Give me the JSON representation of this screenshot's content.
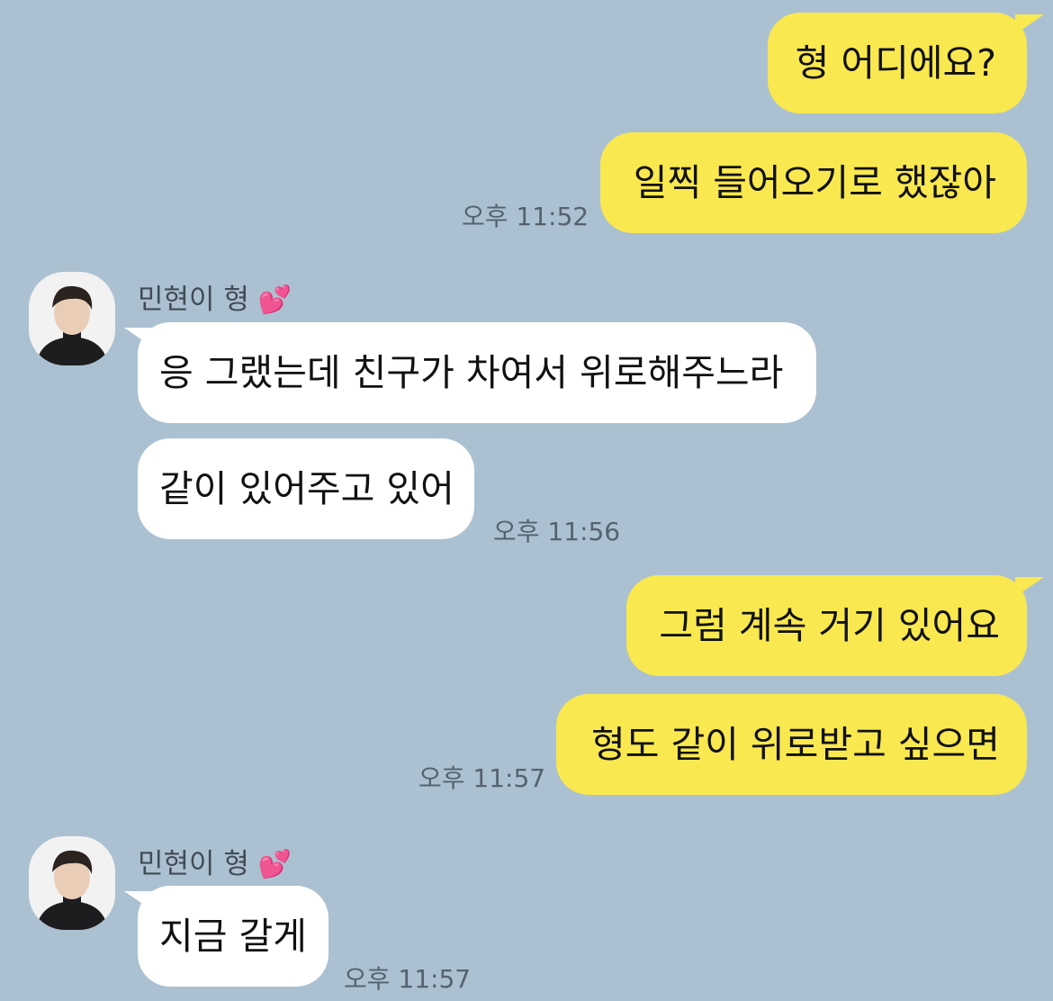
{
  "messages": {
    "m1": "형 어디에요?",
    "m2": "일찍 들어오기로 했잖아",
    "t1": "오후 11:52",
    "sender_name": "민현이 형",
    "heart_icon": "💕",
    "m3": "응 그랬는데 친구가 차여서 위로해주느라",
    "m4": "같이 있어주고 있어",
    "t2": "오후 11:56",
    "m5": "그럼 계속 거기 있어요",
    "m6": "형도 같이 위로받고 싶으면",
    "t3": "오후 11:57",
    "m7": "지금 갈게",
    "t4": "오후 11:57"
  },
  "colors": {
    "background": "#abc1d1",
    "my_bubble": "#f9e84f",
    "their_bubble": "#ffffff"
  }
}
